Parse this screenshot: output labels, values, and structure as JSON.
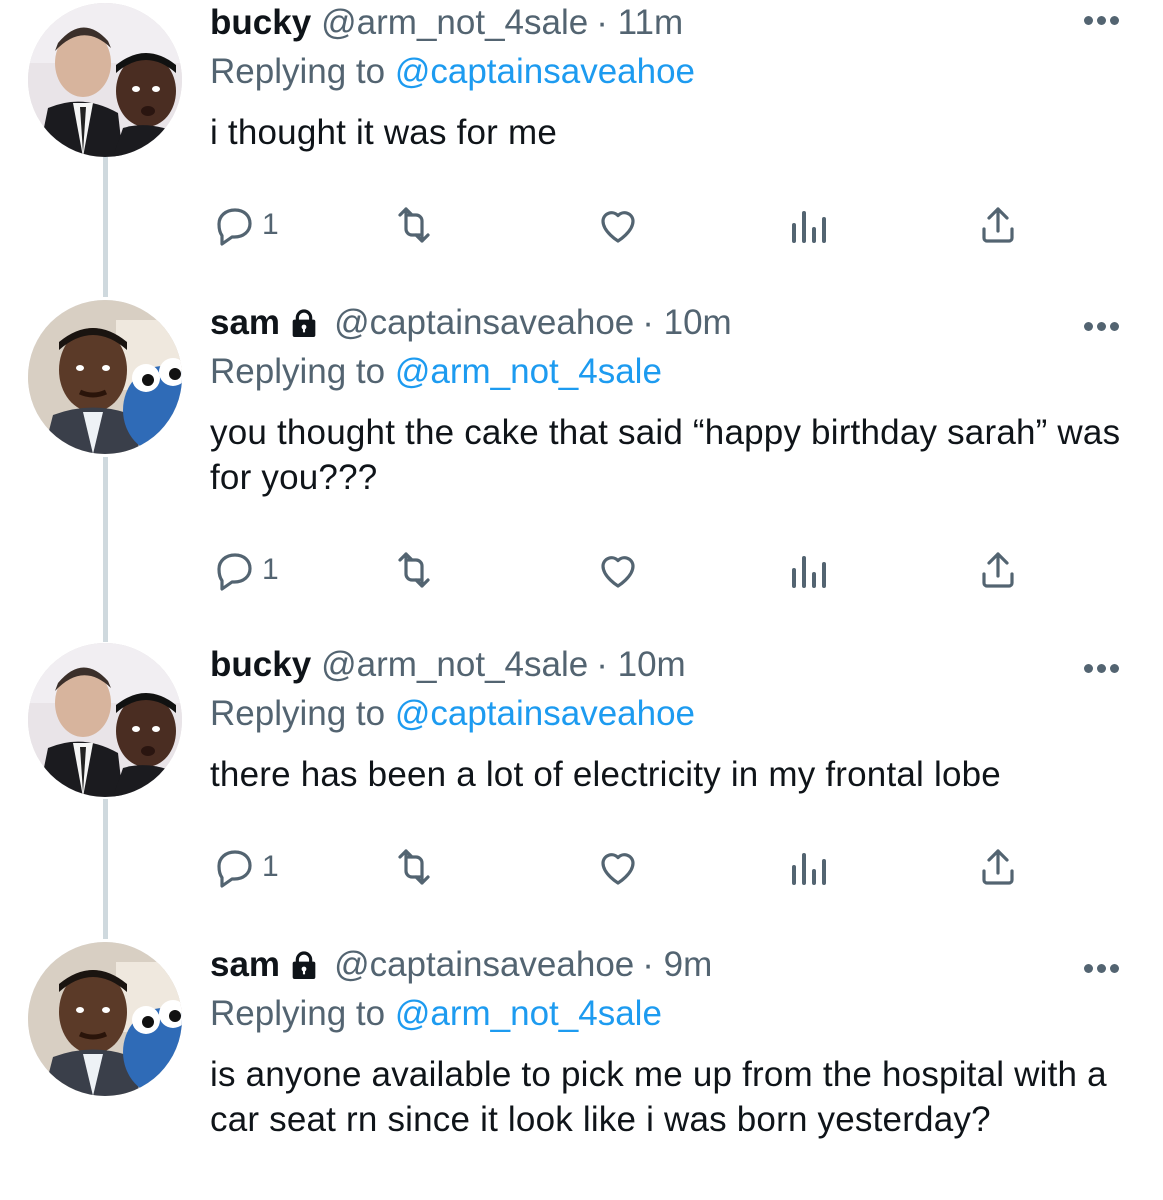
{
  "tweets": [
    {
      "name": "bucky",
      "locked": false,
      "handle": "@arm_not_4sale",
      "time": "· 11m",
      "replying_label": "Replying to",
      "replying_to": "@captainsaveahoe",
      "text": "i thought it was for me",
      "reply_count": "1",
      "avatar": "bucky-avatar"
    },
    {
      "name": "sam",
      "locked": true,
      "handle": "@captainsaveahoe",
      "time": "· 10m",
      "replying_label": "Replying to",
      "replying_to": "@arm_not_4sale",
      "text": "you thought the cake that said “happy birthday sarah” was for you???",
      "reply_count": "1",
      "avatar": "sam-avatar"
    },
    {
      "name": "bucky",
      "locked": false,
      "handle": "@arm_not_4sale",
      "time": "· 10m",
      "replying_label": "Replying to",
      "replying_to": "@captainsaveahoe",
      "text": "there has been a lot of electricity in my frontal lobe",
      "reply_count": "1",
      "avatar": "bucky-avatar"
    },
    {
      "name": "sam",
      "locked": true,
      "handle": "@captainsaveahoe",
      "time": "· 9m",
      "replying_label": "Replying to",
      "replying_to": "@arm_not_4sale",
      "text": "is anyone available to pick me up from the hospital with a car seat rn since it look like i was born yesterday?",
      "reply_count": "",
      "avatar": "sam-avatar"
    }
  ],
  "colors": {
    "accent": "#1d9bf0",
    "muted": "#536471",
    "text": "#0f1419",
    "thread_line": "#cfd9de"
  },
  "icons": [
    "more-icon",
    "lock-icon",
    "reply-icon",
    "retweet-icon",
    "like-icon",
    "views-icon",
    "share-icon"
  ]
}
